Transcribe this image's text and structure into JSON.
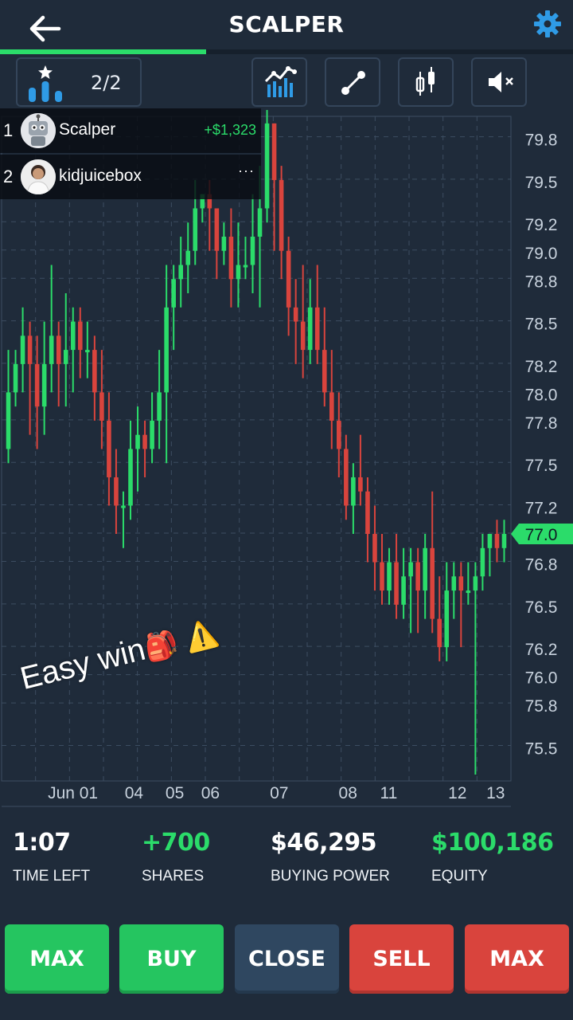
{
  "header": {
    "title": "SCALPER",
    "progress": 0.36
  },
  "toolbar": {
    "rank_text": "2/2",
    "buttons": [
      "ranking-star-icon",
      "indicators-icon",
      "line-tool-icon",
      "candlestick-icon",
      "muted-speaker-icon"
    ]
  },
  "leaderboard": [
    {
      "rank": "1",
      "name": "Scalper",
      "pnl": "+$1,323"
    },
    {
      "rank": "2",
      "name": "kidjuicebox",
      "more": "···"
    }
  ],
  "caption": {
    "text": "Easy win",
    "emoji": "🎒 ⚠️"
  },
  "stats": {
    "time_left": {
      "value": "1:07",
      "label": "TIME LEFT"
    },
    "shares": {
      "value": "+700",
      "label": "SHARES"
    },
    "buying_power": {
      "value": "$46,295",
      "label": "BUYING POWER"
    },
    "equity": {
      "value": "$100,186",
      "label": "EQUITY"
    }
  },
  "actions": {
    "max_buy": "MAX",
    "buy": "BUY",
    "close": "CLOSE",
    "sell": "SELL",
    "max_sell": "MAX"
  },
  "colors": {
    "background": "#1f2b3a",
    "up": "#2bdc6a",
    "down": "#d9443d",
    "grid": "#3c4d61"
  },
  "chart_data": {
    "type": "candlestick",
    "ylim": [
      75.3,
      79.95
    ],
    "y_ticks": [
      "79.8",
      "79.5",
      "79.2",
      "79.0",
      "78.8",
      "78.5",
      "78.2",
      "78.0",
      "77.8",
      "77.5",
      "77.2",
      "77.0",
      "76.8",
      "76.5",
      "76.2",
      "76.0",
      "75.8",
      "75.5"
    ],
    "x_ticks": [
      "Jun 01",
      "04",
      "05",
      "06",
      "07",
      "08",
      "11",
      "12",
      "13"
    ],
    "current_price": "77.0",
    "candles": [
      [
        77.6,
        78.0,
        78.3,
        77.5
      ],
      [
        78.0,
        78.2,
        78.3,
        77.9
      ],
      [
        78.2,
        78.4,
        78.6,
        78.0
      ],
      [
        78.4,
        78.2,
        78.5,
        77.7
      ],
      [
        78.2,
        77.9,
        78.4,
        77.6
      ],
      [
        77.9,
        78.2,
        78.5,
        77.7
      ],
      [
        78.2,
        78.4,
        78.9,
        78.0
      ],
      [
        78.4,
        78.2,
        78.5,
        77.9
      ],
      [
        78.2,
        78.3,
        78.7,
        77.9
      ],
      [
        78.3,
        78.5,
        78.6,
        78.0
      ],
      [
        78.5,
        78.3,
        78.6,
        78.1
      ],
      [
        78.3,
        78.3,
        78.5,
        78.1
      ],
      [
        78.3,
        78.0,
        78.4,
        77.8
      ],
      [
        78.0,
        77.8,
        78.3,
        77.6
      ],
      [
        77.8,
        77.4,
        78.0,
        77.2
      ],
      [
        77.4,
        77.2,
        77.6,
        77.0
      ],
      [
        77.2,
        77.2,
        77.3,
        76.9
      ],
      [
        77.2,
        77.6,
        77.8,
        77.1
      ],
      [
        77.6,
        77.7,
        77.9,
        77.3
      ],
      [
        77.7,
        77.6,
        77.8,
        77.4
      ],
      [
        77.6,
        77.8,
        78.0,
        77.5
      ],
      [
        77.8,
        78.0,
        78.3,
        77.6
      ],
      [
        78.0,
        78.6,
        78.9,
        77.5
      ],
      [
        78.6,
        78.8,
        78.9,
        78.3
      ],
      [
        78.8,
        78.9,
        79.1,
        78.6
      ],
      [
        78.9,
        79.0,
        79.2,
        78.7
      ],
      [
        79.0,
        79.3,
        79.5,
        78.9
      ],
      [
        79.3,
        79.4,
        79.4,
        79.2
      ],
      [
        79.4,
        79.3,
        79.5,
        79.0
      ],
      [
        79.3,
        79.0,
        79.3,
        78.8
      ],
      [
        79.0,
        79.1,
        79.2,
        78.9
      ],
      [
        79.1,
        78.8,
        79.3,
        78.6
      ],
      [
        78.8,
        78.9,
        79.2,
        78.6
      ],
      [
        78.9,
        78.9,
        79.1,
        78.8
      ],
      [
        78.9,
        79.1,
        79.4,
        78.7
      ],
      [
        79.1,
        79.3,
        79.6,
        78.6
      ],
      [
        79.3,
        79.9,
        80.0,
        79.2
      ],
      [
        79.9,
        79.5,
        79.9,
        79.0
      ],
      [
        79.5,
        79.0,
        79.6,
        78.8
      ],
      [
        79.0,
        78.6,
        79.1,
        78.4
      ],
      [
        78.6,
        78.5,
        78.8,
        78.2
      ],
      [
        78.5,
        78.3,
        78.9,
        78.1
      ],
      [
        78.3,
        78.6,
        78.8,
        78.2
      ],
      [
        78.6,
        78.3,
        78.9,
        78.2
      ],
      [
        78.3,
        78.0,
        78.6,
        77.9
      ],
      [
        78.0,
        77.8,
        78.3,
        77.6
      ],
      [
        77.8,
        77.6,
        78.0,
        77.4
      ],
      [
        77.6,
        77.2,
        77.7,
        77.1
      ],
      [
        77.2,
        77.4,
        77.5,
        77.0
      ],
      [
        77.4,
        77.3,
        77.7,
        77.2
      ],
      [
        77.3,
        77.0,
        77.4,
        76.8
      ],
      [
        77.0,
        76.8,
        77.2,
        76.6
      ],
      [
        76.8,
        76.6,
        77.0,
        76.5
      ],
      [
        76.6,
        76.8,
        76.9,
        76.5
      ],
      [
        76.8,
        76.5,
        77.0,
        76.4
      ],
      [
        76.5,
        76.7,
        76.9,
        76.4
      ],
      [
        76.7,
        76.8,
        76.9,
        76.3
      ],
      [
        76.8,
        76.6,
        76.9,
        76.3
      ],
      [
        76.6,
        76.9,
        77.0,
        76.4
      ],
      [
        76.9,
        76.4,
        77.3,
        76.3
      ],
      [
        76.4,
        76.2,
        76.7,
        76.1
      ],
      [
        76.2,
        76.6,
        76.8,
        76.1
      ],
      [
        76.6,
        76.7,
        76.8,
        76.4
      ],
      [
        76.7,
        76.6,
        76.8,
        76.2
      ],
      [
        76.6,
        76.6,
        76.8,
        76.5
      ],
      [
        76.6,
        76.7,
        76.8,
        75.3
      ],
      [
        76.7,
        76.9,
        77.0,
        76.6
      ],
      [
        76.9,
        77.0,
        77.0,
        76.7
      ],
      [
        77.0,
        76.9,
        77.1,
        76.8
      ],
      [
        76.9,
        77.0,
        77.1,
        76.8
      ]
    ]
  }
}
